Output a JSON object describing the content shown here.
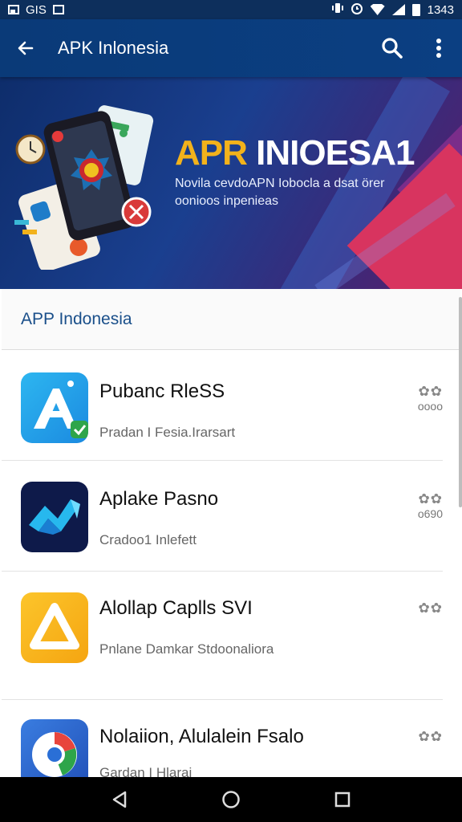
{
  "status_bar": {
    "left_text": "GIS",
    "time": "1343"
  },
  "app_bar": {
    "title": "APK Inlonesia",
    "icons": [
      "back-arrow-icon",
      "search-icon",
      "more-vert-icon"
    ]
  },
  "banner": {
    "headline_accent": "APR",
    "headline_rest": " INIOESA1",
    "subtitle": "Novila cevdoAPN Iobocla a dsat örer oonioos inpenieas",
    "colors": {
      "accent": "#f2b21b",
      "pink": "#d8345f",
      "navy": "#0e2d6b"
    }
  },
  "section": {
    "title": "APP Indonesia"
  },
  "apps": [
    {
      "name": "Pubanc RleSS",
      "subtitle": "Pradan I Fesia.Irarsart",
      "rating": "oooo",
      "stars": "✿✿",
      "icon": "letter-a-icon",
      "color": "#1e9be8"
    },
    {
      "name": "Aplake Pasno",
      "subtitle": "Cradoo1 Inlefett",
      "rating": "o690",
      "stars": "✿✿",
      "icon": "ribbon-logo-icon",
      "color": "#0e1a4a"
    },
    {
      "name": "Alollap Caplls SVI",
      "subtitle": "Pnlane Damkar Stdoonaliora",
      "rating": "",
      "stars": "✿✿",
      "icon": "triangle-logo-icon",
      "color": "#f7b215"
    },
    {
      "name": "Nolaiion, Alulalein Fsalo",
      "subtitle": "Gardan I Hlarai",
      "rating": "",
      "stars": "✿✿",
      "icon": "chrome-like-icon",
      "color": "#2a62c9"
    }
  ],
  "nav_bar": {
    "icons": [
      "nav-back-icon",
      "nav-home-icon",
      "nav-recents-icon"
    ]
  }
}
